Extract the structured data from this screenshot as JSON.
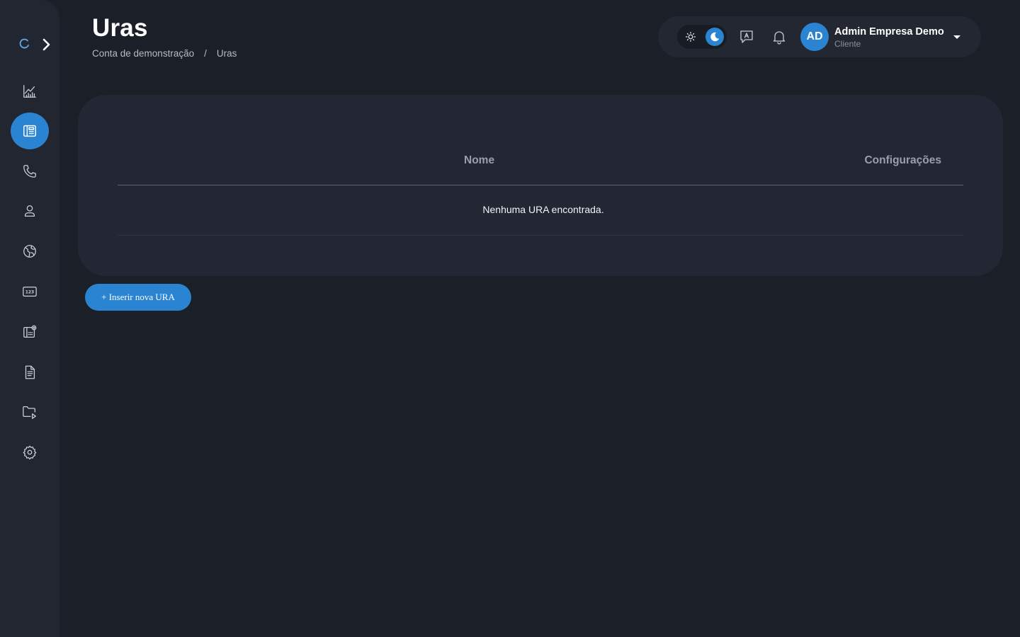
{
  "page": {
    "title": "Uras",
    "breadcrumb": [
      "Conta de demonstração",
      "Uras"
    ],
    "breadcrumb_separator": "/"
  },
  "sidebar": {
    "items": [
      {
        "icon": "chart-icon",
        "active": false
      },
      {
        "icon": "ura-icon",
        "active": true
      },
      {
        "icon": "phone-icon",
        "active": false
      },
      {
        "icon": "user-icon",
        "active": false
      },
      {
        "icon": "globe-icon",
        "active": false
      },
      {
        "icon": "numbers-123-icon",
        "active": false
      },
      {
        "icon": "ura-settings-icon",
        "active": false
      },
      {
        "icon": "document-icon",
        "active": false
      },
      {
        "icon": "media-folder-icon",
        "active": false
      },
      {
        "icon": "gear-icon",
        "active": false
      }
    ]
  },
  "header": {
    "user": {
      "initials": "AD",
      "name": "Admin Empresa Demo",
      "role": "Cliente"
    },
    "theme": "dark"
  },
  "table": {
    "columns": [
      "Nome",
      "Configurações"
    ],
    "empty_message": "Nenhuma URA encontrada."
  },
  "actions": {
    "add_label": "+ Inserir nova URA"
  },
  "colors": {
    "accent": "#2a84d2",
    "background": "#1b1f27",
    "sidebar": "#212630",
    "card": "#222733"
  }
}
